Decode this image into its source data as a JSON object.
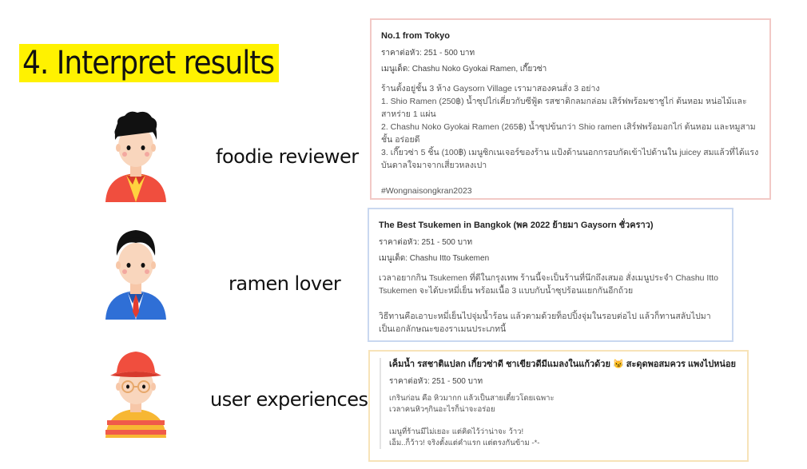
{
  "slide": {
    "title": "4. Interpret results",
    "accent": "#fff200"
  },
  "personas": [
    {
      "label": "foodie reviewer"
    },
    {
      "label": "ramen lover"
    },
    {
      "label": "user experiences"
    }
  ],
  "cards": [
    {
      "header": "No.1 from Tokyo",
      "price": "ราคาต่อหัว: 251 - 500 บาท",
      "menu": "เมนูเด็ด: Chashu Noko Gyokai Ramen, เกี๊ยวซ่า",
      "body": "ร้านตั้งอยู่ชั้น 3 ห้าง Gaysorn Village เรามาสองคนสั่ง 3 อย่าง\n1. Shio Ramen (250฿) น้ำซุปไก่เคี่ยวกับซีฟู้ด รสชาติกลมกล่อม เสิร์ฟพร้อมชาชูไก่ ต้นหอม หน่อไม้และสาหร่าย 1 แผ่น\n2. Chashu Noko Gyokai Ramen (265฿) น้ำซุปข้นกว่า Shio ramen เสิร์ฟพร้อมอกไก่ ต้นหอม และหมูสามชั้น อร่อยดี\n3. เกี๊ยวซ่า 5 ชิ้น (100฿) เมนูซิกเนเจอร์ของร้าน แป้งด้านนอกกรอบกัดเข้าไปด้านใน juicey สมแล้วที่ได้แรงบันดาลใจมาจากเสี่ยวหลงเปา\n\n#Wongnaisongkran2023"
    },
    {
      "header": "The Best Tsukemen in Bangkok (พค 2022 ย้ายมา Gaysorn ชั่วคราว)",
      "price": "ราคาต่อหัว: 251 - 500 บาท",
      "menu": "เมนูเด็ด: Chashu Itto Tsukemen",
      "body": "เวลาอยากกิน Tsukemen ที่ดีในกรุงเทพ ร้านนี้จะเป็นร้านที่นึกถึงเสมอ สั่งเมนูประจำ Chashu Itto Tsukemen จะได้บะหมี่เย็น พร้อมเนื้อ 3 แบบกับน้ำซุปร้อนแยกกันอีกถ้วย\n\nวิธีทานคือเอาบะหมี่เย็นไปจุ่มน้ำร้อน แล้วตามด้วยท็อปปิ้งจุ่มในรอบต่อไป แล้วก็ทานสลับไปมา เป็นเอกลักษณะของราเมนประเภทนี้"
    },
    {
      "header": "เค็มน้ำ รสชาติแปลก เกี๊ยวซ่าดี ชาเขียวดีมีแมลงในแก้วด้วย 😼 สะดุดพอสมควร แพงไปหน่อย",
      "price": "ราคาต่อหัว: 251 - 500 บาท",
      "body": "เกรินก่อน คือ หิวมากก แล้วเป็นสายเตี๋ยวโดยเฉพาะ\nเวลาคนหิวๆกินอะไรก็น่าจะอร่อย\n\nเมนูที่ร้านมีไม่เยอะ แต่คิดไว้ว่าน่าจะ ว้าว!\nเอ็ม..ก็ว้าว! จริงตั้งแต่คำแรก แต่ตรงกันข้าม -*-"
    }
  ],
  "colors": {
    "card1_border": "#f2c9c6",
    "card2_border": "#c9d8f0",
    "card3_border": "#f7e3b8"
  }
}
